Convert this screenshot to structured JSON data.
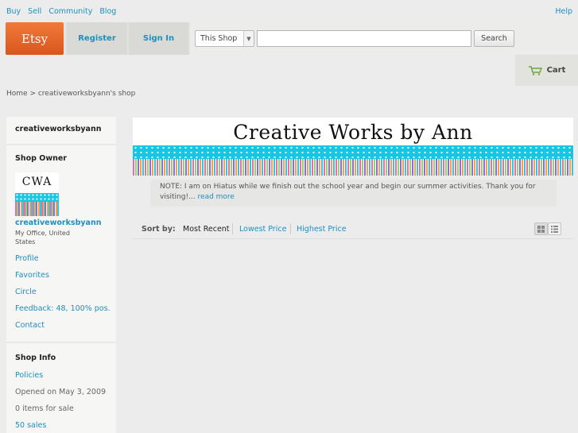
{
  "topnav": {
    "buy": "Buy",
    "sell": "Sell",
    "community": "Community",
    "blog": "Blog",
    "help": "Help"
  },
  "header": {
    "logo": "Etsy",
    "register": "Register",
    "signin": "Sign In",
    "search_scope": "This Shop",
    "search_placeholder": "",
    "search_button": "Search",
    "cart": "Cart"
  },
  "breadcrumb": "Home > creativeworksbyann's shop",
  "sidebar": {
    "shop_name": "creativeworksbyann",
    "owner_heading": "Shop Owner",
    "avatar_text": "CWA",
    "owner_name": "creativeworksbyann",
    "location": "My Office, United States",
    "links": [
      "Profile",
      "Favorites",
      "Circle",
      "Feedback: 48, 100% pos.",
      "Contact"
    ],
    "info_heading": "Shop Info",
    "policies": "Policies",
    "opened": "Opened on May 3, 2009",
    "items": "0 items for sale",
    "sales": "50 sales"
  },
  "banner": {
    "title": "Creative Works by Ann"
  },
  "note": {
    "text": "NOTE: I am on Hiatus while we finish out the school year and begin our summer activities. Thank you for visiting!...",
    "more": "read more"
  },
  "sort": {
    "label": "Sort by:",
    "options": [
      "Most Recent",
      "Lowest Price",
      "Highest Price"
    ]
  },
  "colors": {
    "link": "#1d8fc1",
    "logo": "#e8662a",
    "banner_cyan": "#17c6e2"
  }
}
